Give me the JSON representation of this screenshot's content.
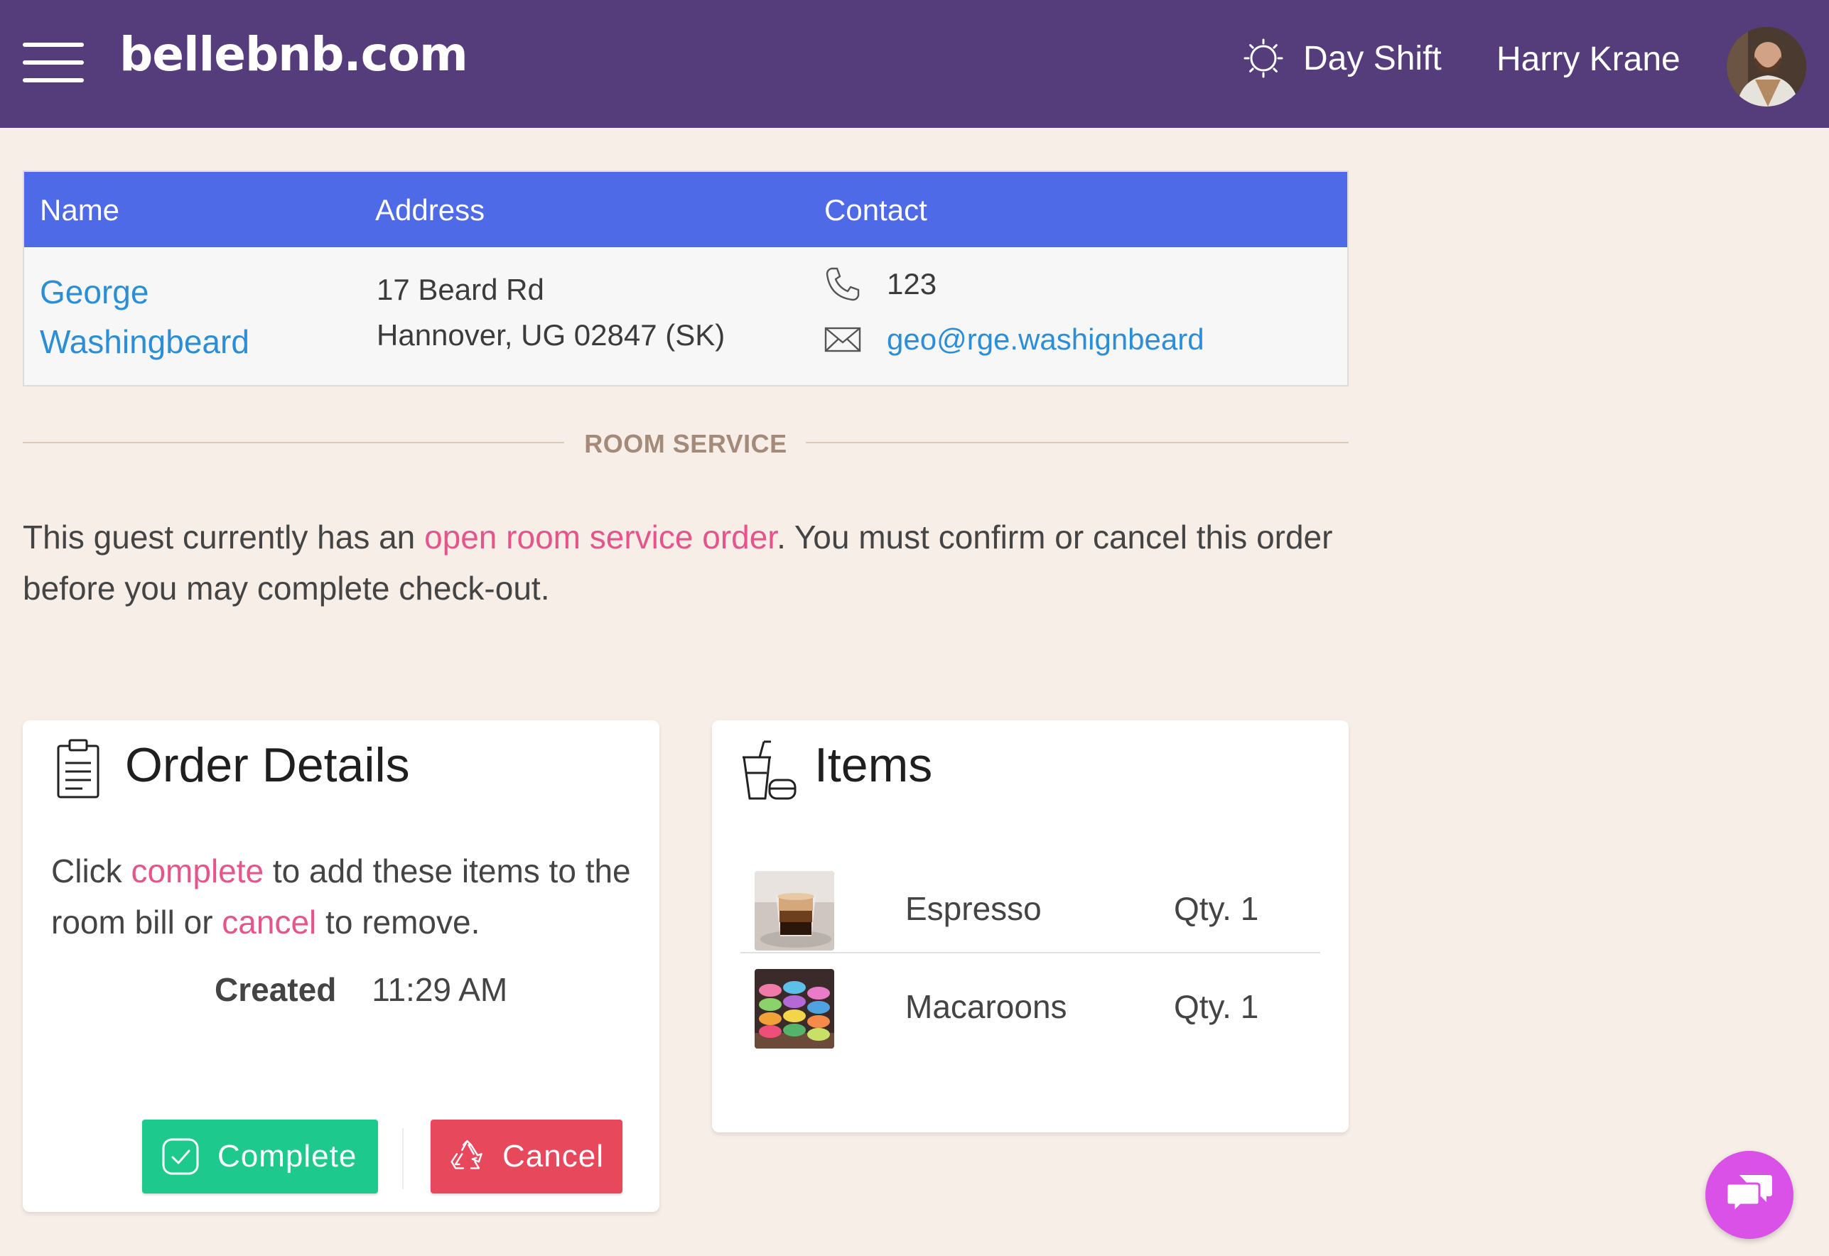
{
  "header": {
    "brand": "bellebnb.com",
    "shift_label": "Day Shift",
    "user_name": "Harry Krane",
    "colors": {
      "bar": "#553d7c"
    }
  },
  "guest_table": {
    "columns": [
      "Name",
      "Address",
      "Contact"
    ],
    "guest": {
      "name": "George Washingbeard",
      "address_line1": "17 Beard Rd",
      "address_line2": "Hannover, UG 02847 (SK)",
      "phone": "123",
      "email": "geo@rge.washignbeard"
    },
    "colors": {
      "header": "#4f6ae6",
      "link": "#2b8ed6"
    }
  },
  "section": {
    "title": "ROOM SERVICE"
  },
  "notice": {
    "before": "This guest currently has an ",
    "link": "open room service order",
    "after": ". You must confirm or cancel this order before you may complete check-out."
  },
  "order_details": {
    "title": "Order Details",
    "text_1": "Click ",
    "link_complete": "complete",
    "text_2": " to add these items to the room bill or ",
    "link_cancel": "cancel",
    "text_3": " to remove.",
    "created_label": "Created",
    "created_value": "11:29 AM",
    "complete_label": "Complete",
    "cancel_label": "Cancel",
    "colors": {
      "complete": "#1dc98d",
      "cancel": "#e8485c",
      "link": "#e5548a"
    }
  },
  "items": {
    "title": "Items",
    "list": [
      {
        "name": "Espresso",
        "qty": "Qty. 1"
      },
      {
        "name": "Macaroons",
        "qty": "Qty. 1"
      }
    ]
  },
  "icons": {
    "menu": "hamburger-icon",
    "shift": "sun-icon",
    "phone": "phone-icon",
    "email": "envelope-icon",
    "order": "clipboard-icon",
    "items": "drink-food-icon",
    "complete": "check-icon",
    "cancel": "recycle-icon",
    "chat": "chat-icon"
  },
  "chat_color": "#d951e6"
}
